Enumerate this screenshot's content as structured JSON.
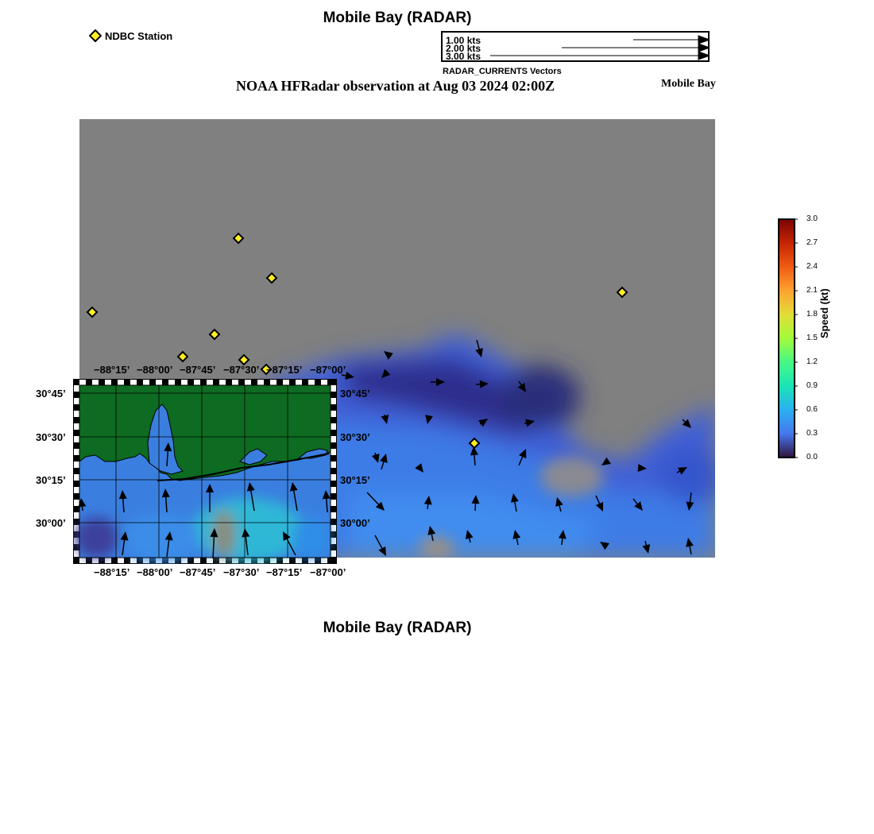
{
  "header": {
    "title": "Mobile Bay (RADAR)",
    "station_legend": "NDBC Station",
    "vector_legend": {
      "entries": [
        "1.00 kts",
        "2.00 kts",
        "3.00 kts"
      ],
      "caption": "RADAR_CURRENTS Vectors"
    },
    "observation_title": "NOAA HFRadar observation at Aug 03 2024 02:00Z",
    "region_label": "Mobile Bay"
  },
  "colorbar": {
    "label": "Speed (kt)",
    "ticks": [
      "3.0",
      "2.7",
      "2.4",
      "2.1",
      "1.8",
      "1.5",
      "1.2",
      "0.9",
      "0.6",
      "0.3",
      "0.0"
    ],
    "colors": [
      "#7a0403",
      "#c42503",
      "#f05b12",
      "#fea331",
      "#e1dd37",
      "#a2fc3c",
      "#46f884",
      "#1ae4b6",
      "#2ab0f0",
      "#4777ef",
      "#30123b"
    ]
  },
  "map": {
    "background_color": "#808080",
    "ocean_color": "#3a7fe0",
    "land_color": "#0d6b22",
    "station_color": "#ffee22",
    "lon_ticks": [
      "−88°15’",
      "−88°00’",
      "−87°45’",
      "−87°30’",
      "−87°15’",
      "−87°00’"
    ],
    "lat_ticks": [
      "30°45’",
      "30°30’",
      "30°15’",
      "30°00’"
    ]
  },
  "footer": {
    "title": "Mobile Bay (RADAR)"
  }
}
